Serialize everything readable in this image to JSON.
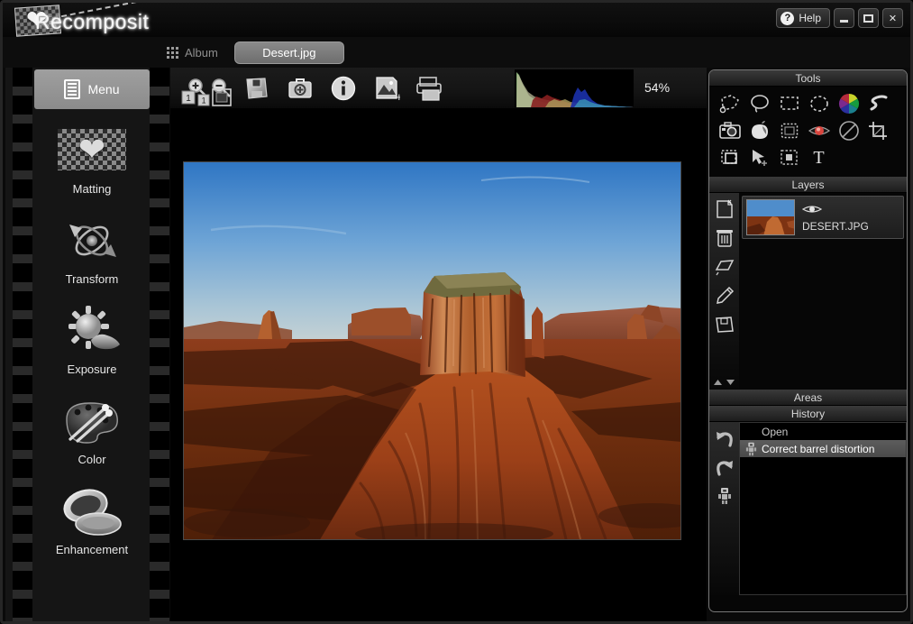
{
  "app": {
    "name": "Recomposit",
    "logo_icon": "heart-on-checkerboard-logo"
  },
  "titlebar": {
    "help_label": "Help",
    "help_icon": "question-mark-icon",
    "minimize_icon": "minimize-icon",
    "maximize_icon": "maximize-icon",
    "close_icon": "close-icon",
    "close_glyph": "✕"
  },
  "tabs": {
    "album_label": "Album",
    "album_icon": "grid-icon",
    "active_file": "Desert.jpg"
  },
  "sidebar": {
    "menu_label": "Menu",
    "menu_icon": "document-menu-icon",
    "items": [
      {
        "label": "Matting",
        "icon": "heart-matting-icon"
      },
      {
        "label": "Transform",
        "icon": "rotate-transform-icon"
      },
      {
        "label": "Exposure",
        "icon": "sun-exposure-icon"
      },
      {
        "label": "Color",
        "icon": "palette-color-icon"
      },
      {
        "label": "Enhancement",
        "icon": "compact-mirror-enhancement-icon"
      }
    ]
  },
  "toolbar": {
    "buttons": [
      {
        "name": "zoom-in-icon",
        "tip": "Zoom In"
      },
      {
        "name": "zoom-out-icon",
        "tip": "Zoom Out"
      },
      {
        "name": "zoom-actual-icon",
        "tip": "Actual Size 1:1"
      },
      {
        "name": "zoom-fit-icon",
        "tip": "Fit To Window"
      },
      {
        "name": "save-icon",
        "tip": "Save"
      },
      {
        "name": "toolbox-icon",
        "tip": "Repair Toolbox"
      },
      {
        "name": "info-icon",
        "tip": "Image Info"
      },
      {
        "name": "add-image-icon",
        "tip": "Add Image"
      },
      {
        "name": "print-icon",
        "tip": "Print"
      }
    ],
    "zoom_level": "54%"
  },
  "histogram": {
    "title": "RGB Histogram",
    "channels": [
      "red",
      "green",
      "blue"
    ]
  },
  "tools_panel": {
    "title": "Tools",
    "tools": [
      {
        "name": "polygon-select-tool-icon",
        "label": "Polygon Select"
      },
      {
        "name": "lasso-select-tool-icon",
        "label": "Lasso"
      },
      {
        "name": "rectangle-select-tool-icon",
        "label": "Rectangle Select"
      },
      {
        "name": "ellipse-select-tool-icon",
        "label": "Ellipse Select"
      },
      {
        "name": "color-wheel-tool-icon",
        "label": "Color Wheel"
      },
      {
        "name": "scribble-tool-icon",
        "label": "Scribble Select"
      },
      {
        "name": "camera-clone-tool-icon",
        "label": "Clone Stamp"
      },
      {
        "name": "magic-wand-tool-icon",
        "label": "Magic Wand"
      },
      {
        "name": "marching-ants-tool-icon",
        "label": "Refine Selection"
      },
      {
        "name": "red-eye-tool-icon",
        "label": "Red Eye Removal"
      },
      {
        "name": "none-tool-icon",
        "label": "Deselect"
      },
      {
        "name": "crop-tool-icon",
        "label": "Crop"
      },
      {
        "name": "transform-box-tool-icon",
        "label": "Free Transform"
      },
      {
        "name": "move-pointer-tool-icon",
        "label": "Move"
      },
      {
        "name": "mask-tool-icon",
        "label": "Mask"
      },
      {
        "name": "text-tool-icon",
        "label": "Text"
      }
    ],
    "text_tool_glyph": "T"
  },
  "layers_panel": {
    "title": "Layers",
    "buttons": [
      {
        "name": "new-layer-icon",
        "label": "New Layer"
      },
      {
        "name": "delete-layer-icon",
        "label": "Delete Layer"
      },
      {
        "name": "duplicate-layer-icon",
        "label": "Duplicate Layer"
      },
      {
        "name": "edit-layer-icon",
        "label": "Edit Layer"
      },
      {
        "name": "save-layer-icon",
        "label": "Save Layer"
      }
    ],
    "move_up_icon": "move-layer-up-icon",
    "move_down_icon": "move-layer-down-icon",
    "layers": [
      {
        "name": "DESERT.JPG",
        "visible": true,
        "visibility_icon": "eye-icon"
      }
    ]
  },
  "areas_panel": {
    "title": "Areas"
  },
  "history_panel": {
    "title": "History",
    "undo_icon": "undo-arrow-icon",
    "redo_icon": "redo-arrow-icon",
    "automation_icon": "robot-automation-icon",
    "entries": [
      {
        "label": "Open",
        "selected": false,
        "icon": ""
      },
      {
        "label": "Correct barrel distortion",
        "selected": true,
        "icon": "robot-icon"
      }
    ]
  },
  "colors": {
    "panel_bg": "#060606",
    "window_bg": "#0a0a0a",
    "accent_tab": "#8a8a8a",
    "selection": "#5d5d5d",
    "text": "#dcdcdc",
    "sky_top": "#2f76c4",
    "sky_bottom": "#b8cdd8",
    "rock": "#a8421a",
    "rock_lit": "#d4774a",
    "ground_shadow": "#4a1c0c"
  }
}
